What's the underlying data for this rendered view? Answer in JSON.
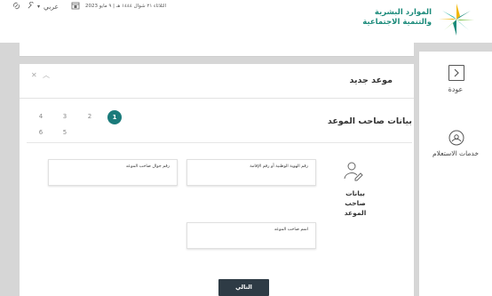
{
  "header": {
    "logo_line1": "الموارد البشرية",
    "logo_line2": "والتنمية الاجتماعية",
    "language": "عربي",
    "date": "الثلاثاء ٢١ شوال ١٤٤٤ هـ | ٩ مايو 2023",
    "icons": [
      "link-icon",
      "wrench-icon",
      "calendar-icon"
    ]
  },
  "sidebar": {
    "back_label": "عودة",
    "inquiry_label": "خدمات الاستعلام"
  },
  "card": {
    "title": "موعد جديد",
    "section_title": "بيانات صاحب الموعد",
    "steps": [
      "1",
      "2",
      "3",
      "4",
      "5",
      "6"
    ],
    "active_step": 1,
    "user_label": "بيانات صاحب الموعد"
  },
  "form": {
    "id_label": "رقم الهوية الوطنية أو رقم الإقامة",
    "mobile_label": "رقم جوال صاحب الموعد",
    "name_label": "اسم صاحب الموعد",
    "next_label": "التالي"
  },
  "colors": {
    "accent": "#1b7b7b",
    "button": "#2e3b45",
    "canvas": "#d6d6d6",
    "logo_green": "#1a8a7a"
  }
}
